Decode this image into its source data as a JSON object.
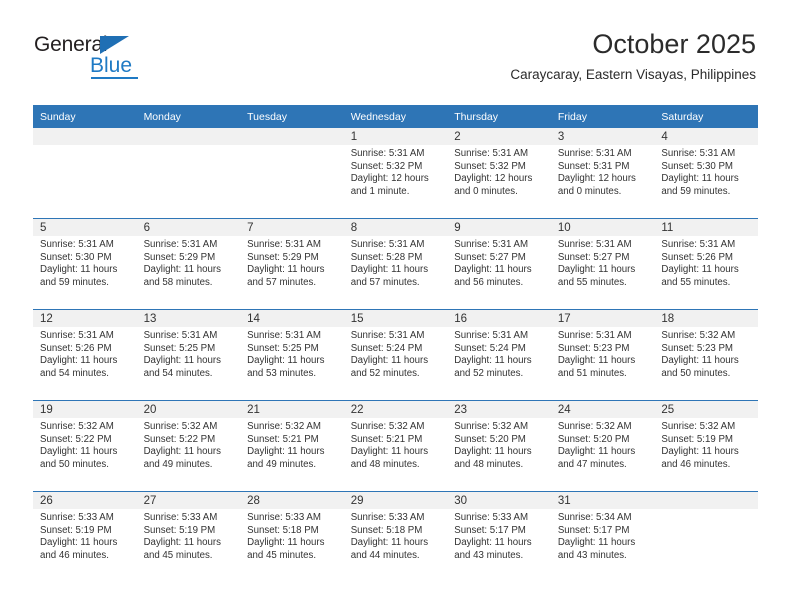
{
  "brand": {
    "name_top": "General",
    "name_bottom": "Blue",
    "accent_color": "#1f7ac4"
  },
  "header": {
    "month_title": "October 2025",
    "location": "Caraycaray, Eastern Visayas, Philippines"
  },
  "theme": {
    "header_blue": "#2e75b6",
    "daynum_band": "#f1f1f1",
    "text": "#333333"
  },
  "weekday_headers": [
    "Sunday",
    "Monday",
    "Tuesday",
    "Wednesday",
    "Thursday",
    "Friday",
    "Saturday"
  ],
  "weeks": [
    [
      {
        "day": "",
        "sunrise": "",
        "sunset": "",
        "daylight_line1": "",
        "daylight_line2": ""
      },
      {
        "day": "",
        "sunrise": "",
        "sunset": "",
        "daylight_line1": "",
        "daylight_line2": ""
      },
      {
        "day": "",
        "sunrise": "",
        "sunset": "",
        "daylight_line1": "",
        "daylight_line2": ""
      },
      {
        "day": "1",
        "sunrise": "Sunrise: 5:31 AM",
        "sunset": "Sunset: 5:32 PM",
        "daylight_line1": "Daylight: 12 hours",
        "daylight_line2": "and 1 minute."
      },
      {
        "day": "2",
        "sunrise": "Sunrise: 5:31 AM",
        "sunset": "Sunset: 5:32 PM",
        "daylight_line1": "Daylight: 12 hours",
        "daylight_line2": "and 0 minutes."
      },
      {
        "day": "3",
        "sunrise": "Sunrise: 5:31 AM",
        "sunset": "Sunset: 5:31 PM",
        "daylight_line1": "Daylight: 12 hours",
        "daylight_line2": "and 0 minutes."
      },
      {
        "day": "4",
        "sunrise": "Sunrise: 5:31 AM",
        "sunset": "Sunset: 5:30 PM",
        "daylight_line1": "Daylight: 11 hours",
        "daylight_line2": "and 59 minutes."
      }
    ],
    [
      {
        "day": "5",
        "sunrise": "Sunrise: 5:31 AM",
        "sunset": "Sunset: 5:30 PM",
        "daylight_line1": "Daylight: 11 hours",
        "daylight_line2": "and 59 minutes."
      },
      {
        "day": "6",
        "sunrise": "Sunrise: 5:31 AM",
        "sunset": "Sunset: 5:29 PM",
        "daylight_line1": "Daylight: 11 hours",
        "daylight_line2": "and 58 minutes."
      },
      {
        "day": "7",
        "sunrise": "Sunrise: 5:31 AM",
        "sunset": "Sunset: 5:29 PM",
        "daylight_line1": "Daylight: 11 hours",
        "daylight_line2": "and 57 minutes."
      },
      {
        "day": "8",
        "sunrise": "Sunrise: 5:31 AM",
        "sunset": "Sunset: 5:28 PM",
        "daylight_line1": "Daylight: 11 hours",
        "daylight_line2": "and 57 minutes."
      },
      {
        "day": "9",
        "sunrise": "Sunrise: 5:31 AM",
        "sunset": "Sunset: 5:27 PM",
        "daylight_line1": "Daylight: 11 hours",
        "daylight_line2": "and 56 minutes."
      },
      {
        "day": "10",
        "sunrise": "Sunrise: 5:31 AM",
        "sunset": "Sunset: 5:27 PM",
        "daylight_line1": "Daylight: 11 hours",
        "daylight_line2": "and 55 minutes."
      },
      {
        "day": "11",
        "sunrise": "Sunrise: 5:31 AM",
        "sunset": "Sunset: 5:26 PM",
        "daylight_line1": "Daylight: 11 hours",
        "daylight_line2": "and 55 minutes."
      }
    ],
    [
      {
        "day": "12",
        "sunrise": "Sunrise: 5:31 AM",
        "sunset": "Sunset: 5:26 PM",
        "daylight_line1": "Daylight: 11 hours",
        "daylight_line2": "and 54 minutes."
      },
      {
        "day": "13",
        "sunrise": "Sunrise: 5:31 AM",
        "sunset": "Sunset: 5:25 PM",
        "daylight_line1": "Daylight: 11 hours",
        "daylight_line2": "and 54 minutes."
      },
      {
        "day": "14",
        "sunrise": "Sunrise: 5:31 AM",
        "sunset": "Sunset: 5:25 PM",
        "daylight_line1": "Daylight: 11 hours",
        "daylight_line2": "and 53 minutes."
      },
      {
        "day": "15",
        "sunrise": "Sunrise: 5:31 AM",
        "sunset": "Sunset: 5:24 PM",
        "daylight_line1": "Daylight: 11 hours",
        "daylight_line2": "and 52 minutes."
      },
      {
        "day": "16",
        "sunrise": "Sunrise: 5:31 AM",
        "sunset": "Sunset: 5:24 PM",
        "daylight_line1": "Daylight: 11 hours",
        "daylight_line2": "and 52 minutes."
      },
      {
        "day": "17",
        "sunrise": "Sunrise: 5:31 AM",
        "sunset": "Sunset: 5:23 PM",
        "daylight_line1": "Daylight: 11 hours",
        "daylight_line2": "and 51 minutes."
      },
      {
        "day": "18",
        "sunrise": "Sunrise: 5:32 AM",
        "sunset": "Sunset: 5:23 PM",
        "daylight_line1": "Daylight: 11 hours",
        "daylight_line2": "and 50 minutes."
      }
    ],
    [
      {
        "day": "19",
        "sunrise": "Sunrise: 5:32 AM",
        "sunset": "Sunset: 5:22 PM",
        "daylight_line1": "Daylight: 11 hours",
        "daylight_line2": "and 50 minutes."
      },
      {
        "day": "20",
        "sunrise": "Sunrise: 5:32 AM",
        "sunset": "Sunset: 5:22 PM",
        "daylight_line1": "Daylight: 11 hours",
        "daylight_line2": "and 49 minutes."
      },
      {
        "day": "21",
        "sunrise": "Sunrise: 5:32 AM",
        "sunset": "Sunset: 5:21 PM",
        "daylight_line1": "Daylight: 11 hours",
        "daylight_line2": "and 49 minutes."
      },
      {
        "day": "22",
        "sunrise": "Sunrise: 5:32 AM",
        "sunset": "Sunset: 5:21 PM",
        "daylight_line1": "Daylight: 11 hours",
        "daylight_line2": "and 48 minutes."
      },
      {
        "day": "23",
        "sunrise": "Sunrise: 5:32 AM",
        "sunset": "Sunset: 5:20 PM",
        "daylight_line1": "Daylight: 11 hours",
        "daylight_line2": "and 48 minutes."
      },
      {
        "day": "24",
        "sunrise": "Sunrise: 5:32 AM",
        "sunset": "Sunset: 5:20 PM",
        "daylight_line1": "Daylight: 11 hours",
        "daylight_line2": "and 47 minutes."
      },
      {
        "day": "25",
        "sunrise": "Sunrise: 5:32 AM",
        "sunset": "Sunset: 5:19 PM",
        "daylight_line1": "Daylight: 11 hours",
        "daylight_line2": "and 46 minutes."
      }
    ],
    [
      {
        "day": "26",
        "sunrise": "Sunrise: 5:33 AM",
        "sunset": "Sunset: 5:19 PM",
        "daylight_line1": "Daylight: 11 hours",
        "daylight_line2": "and 46 minutes."
      },
      {
        "day": "27",
        "sunrise": "Sunrise: 5:33 AM",
        "sunset": "Sunset: 5:19 PM",
        "daylight_line1": "Daylight: 11 hours",
        "daylight_line2": "and 45 minutes."
      },
      {
        "day": "28",
        "sunrise": "Sunrise: 5:33 AM",
        "sunset": "Sunset: 5:18 PM",
        "daylight_line1": "Daylight: 11 hours",
        "daylight_line2": "and 45 minutes."
      },
      {
        "day": "29",
        "sunrise": "Sunrise: 5:33 AM",
        "sunset": "Sunset: 5:18 PM",
        "daylight_line1": "Daylight: 11 hours",
        "daylight_line2": "and 44 minutes."
      },
      {
        "day": "30",
        "sunrise": "Sunrise: 5:33 AM",
        "sunset": "Sunset: 5:17 PM",
        "daylight_line1": "Daylight: 11 hours",
        "daylight_line2": "and 43 minutes."
      },
      {
        "day": "31",
        "sunrise": "Sunrise: 5:34 AM",
        "sunset": "Sunset: 5:17 PM",
        "daylight_line1": "Daylight: 11 hours",
        "daylight_line2": "and 43 minutes."
      },
      {
        "day": "",
        "sunrise": "",
        "sunset": "",
        "daylight_line1": "",
        "daylight_line2": ""
      }
    ]
  ]
}
